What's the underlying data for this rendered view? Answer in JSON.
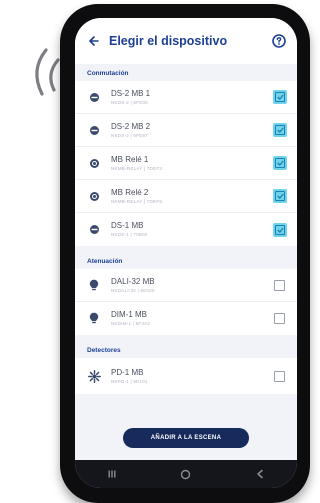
{
  "header": {
    "title": "Elegir el dispositivo",
    "back_icon": "arrow-left-icon",
    "help_icon": "help-circle-icon"
  },
  "sections": [
    {
      "title": "Conmutación",
      "items": [
        {
          "name": "DS-2 MB 1",
          "model": "NKDS-2 | 6FE06",
          "icon": "switch-module-icon",
          "checked": true
        },
        {
          "name": "DS-2 MB 2",
          "model": "NKDS-2 | 6FE87",
          "icon": "switch-module-icon",
          "checked": true
        },
        {
          "name": "MB Relé 1",
          "model": "NKMB-RELAY | 7DEF3",
          "icon": "relay-icon",
          "checked": true
        },
        {
          "name": "MB Relé 2",
          "model": "NKMB-RELAY | 7DEF5",
          "icon": "relay-icon",
          "checked": true
        },
        {
          "name": "DS-1 MB",
          "model": "NKDS-1 | 70B02",
          "icon": "switch-module-icon",
          "checked": true
        }
      ]
    },
    {
      "title": "Atenuación",
      "items": [
        {
          "name": "DALI-32 MB",
          "model": "NKDALI-32 | 6E020",
          "icon": "bulb-icon",
          "checked": false
        },
        {
          "name": "DIM-1 MB",
          "model": "NKDIM-1 | 6F3A2",
          "icon": "bulb-icon",
          "checked": false
        }
      ]
    },
    {
      "title": "Detectores",
      "items": [
        {
          "name": "PD-1 MB",
          "model": "NKPD-1 | 6E101",
          "icon": "motion-sensor-icon",
          "checked": false
        }
      ]
    }
  ],
  "cta_label": "AÑADIR A LA ESCENA",
  "colors": {
    "accent": "#1c3f94",
    "checkbox_fill": "#6fd3ea",
    "button": "#162a5c"
  }
}
